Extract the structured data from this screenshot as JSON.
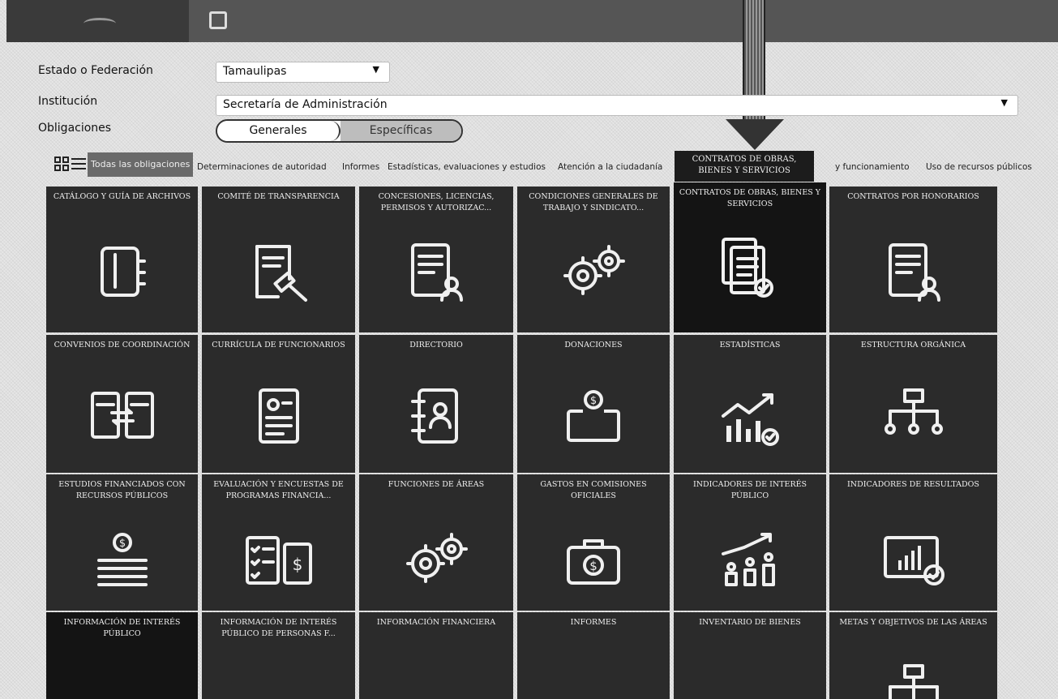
{
  "form": {
    "estado_label": "Estado o Federación",
    "estado_value": "Tamaulipas",
    "institucion_label": "Institución",
    "institucion_value": "Secretaría de Administración",
    "obligaciones_label": "Obligaciones",
    "toggle_generales": "Generales",
    "toggle_especificas": "Específicas"
  },
  "filters": {
    "all": "Todas las obligaciones",
    "items": [
      "Determinaciones de autoridad",
      "Informes",
      "Estadísticas, evaluaciones y estudios",
      "Atención a la ciudadanía",
      "y funcionamiento",
      "Uso de recursos públicos"
    ]
  },
  "callout": "CONTRATOS DE OBRAS, BIENES Y SERVICIOS",
  "tiles": [
    {
      "title": "CATÁLOGO Y GUÍA DE ARCHIVOS",
      "icon": "binder-icon"
    },
    {
      "title": "COMITÉ DE TRANSPARENCIA",
      "icon": "gavel-document-icon"
    },
    {
      "title": "CONCESIONES, LICENCIAS, PERMISOS Y AUTORIZAC...",
      "icon": "document-user-icon"
    },
    {
      "title": "CONDICIONES GENERALES DE TRABAJO Y SINDICATO...",
      "icon": "gears-icon"
    },
    {
      "title": "CONTRATOS DE OBRAS, BIENES Y SERVICIOS",
      "icon": "documents-check-icon"
    },
    {
      "title": "CONTRATOS POR HONORARIOS",
      "icon": "document-user-icon"
    },
    {
      "title": "CONVENIOS DE COORDINACIÓN",
      "icon": "exchange-documents-icon"
    },
    {
      "title": "CURRÍCULA DE FUNCIONARIOS",
      "icon": "resume-icon"
    },
    {
      "title": "DIRECTORIO",
      "icon": "address-book-icon"
    },
    {
      "title": "DONACIONES",
      "icon": "donation-box-icon"
    },
    {
      "title": "ESTADÍSTICAS",
      "icon": "bar-chart-icon"
    },
    {
      "title": "ESTRUCTURA ORGÁNICA",
      "icon": "org-chart-icon"
    },
    {
      "title": "ESTUDIOS FINANCIADOS CON RECURSOS PÚBLICOS",
      "icon": "coin-books-icon"
    },
    {
      "title": "EVALUACIÓN Y ENCUESTAS DE PROGRAMAS FINANCIA...",
      "icon": "checklist-money-icon"
    },
    {
      "title": "FUNCIONES DE ÁREAS",
      "icon": "gears-icon"
    },
    {
      "title": "GASTOS EN COMISIONES OFICIALES",
      "icon": "briefcase-money-icon"
    },
    {
      "title": "INDICADORES DE INTERÉS PÚBLICO",
      "icon": "people-growth-icon"
    },
    {
      "title": "INDICADORES DE RESULTADOS",
      "icon": "monitor-chart-icon"
    },
    {
      "title": "INFORMACIÓN DE INTERÉS PÚBLICO",
      "icon": "pin-icon"
    },
    {
      "title": "INFORMACIÓN DE INTERÉS PÚBLICO DE PERSONAS F...",
      "icon": "document-icon"
    },
    {
      "title": "INFORMACIÓN FINANCIERA",
      "icon": "document-icon"
    },
    {
      "title": "INFORMES",
      "icon": "document-icon"
    },
    {
      "title": "INVENTARIO DE BIENES",
      "icon": "document-icon"
    },
    {
      "title": "METAS Y OBJETIVOS DE LAS ÁREAS",
      "icon": "org-chart-icon"
    }
  ]
}
